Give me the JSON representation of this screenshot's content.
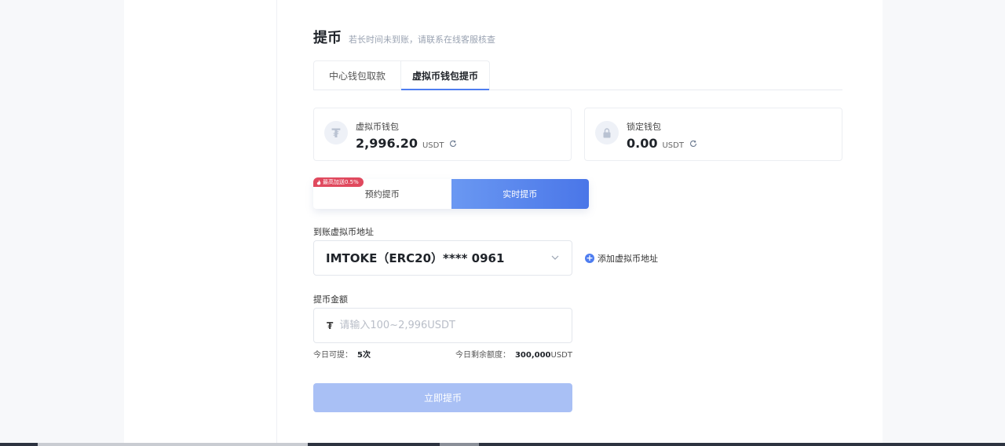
{
  "header": {
    "title": "提币",
    "subtitle": "若长时间未到账，请联系在线客服核查"
  },
  "tabs": [
    {
      "label": "中心钱包取款",
      "active": false
    },
    {
      "label": "虚拟币钱包提币",
      "active": true
    }
  ],
  "wallets": {
    "crypto": {
      "label": "虚拟币钱包",
      "amount": "2,996.20",
      "unit": "USDT",
      "icon": "tether-icon"
    },
    "locked": {
      "label": "锁定钱包",
      "amount": "0.00",
      "unit": "USDT",
      "icon": "lock-icon"
    }
  },
  "mode": {
    "badge": "最高加送0.5%",
    "schedule_label": "预约提币",
    "realtime_label": "实时提币",
    "selected": "realtime"
  },
  "address": {
    "label": "到账虚拟币地址",
    "value": "IMTOKE（ERC20）**** 0961",
    "add_label": "添加虚拟币地址"
  },
  "amount": {
    "label": "提币金额",
    "placeholder": "请输入100~2,996USDT",
    "value": "",
    "today_times_label": "今日可提：",
    "today_times_value": "5次",
    "today_remaining_label": "今日剩余额度：",
    "today_remaining_value": "300,000",
    "today_remaining_unit": "USDT"
  },
  "submit_label": "立即提币",
  "colors": {
    "accent": "#4e7df0",
    "badge": "#e0495e",
    "disabled_button": "#a9c0f5"
  }
}
